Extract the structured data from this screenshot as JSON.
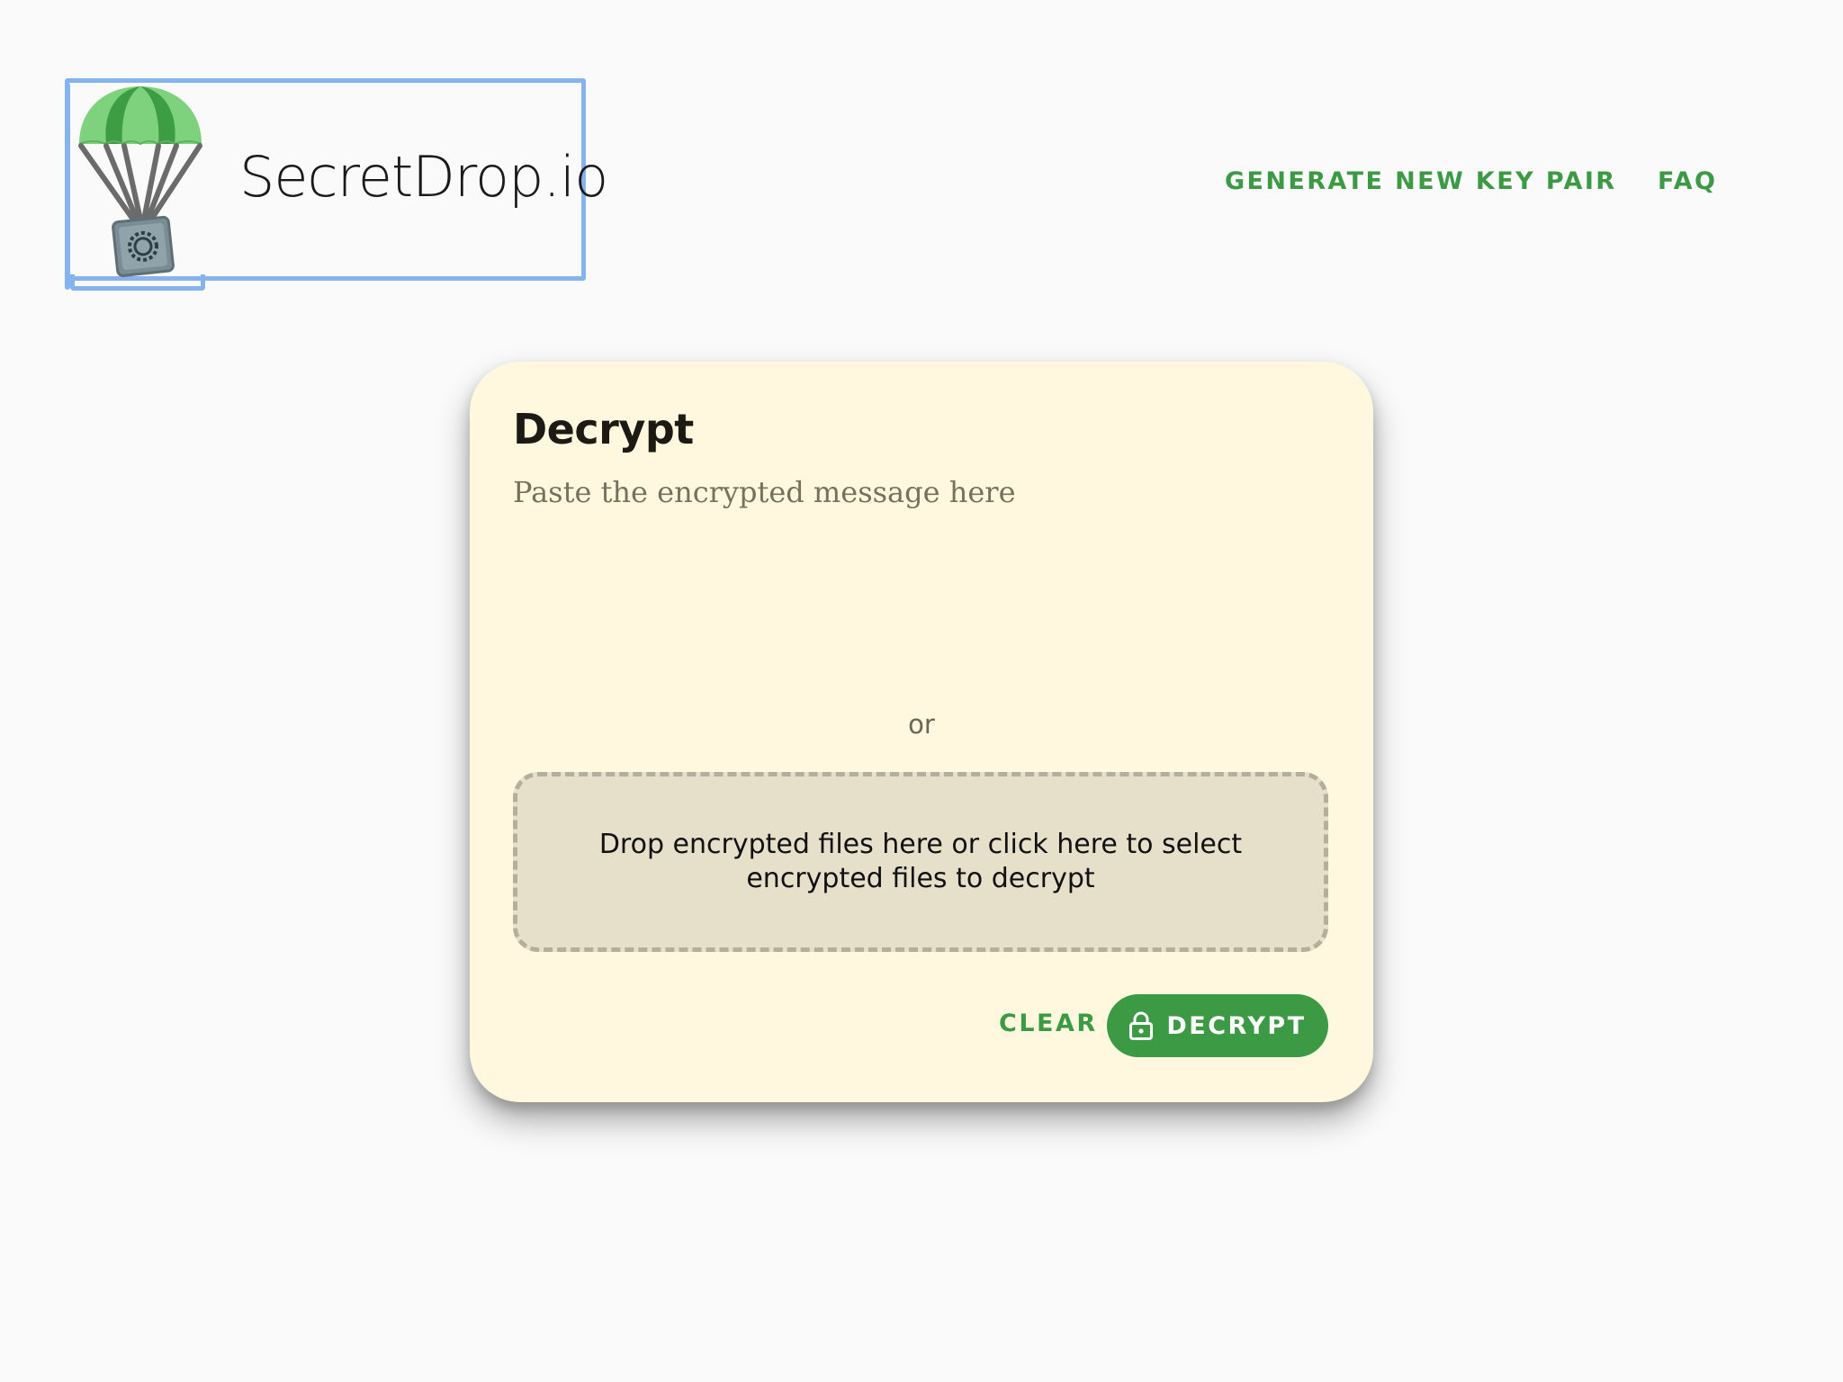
{
  "header": {
    "brand_name": "SecretDrop.io",
    "nav": {
      "generate_label": "GENERATE NEW KEY PAIR",
      "faq_label": "FAQ"
    }
  },
  "decrypt_card": {
    "title": "Decrypt",
    "message_placeholder": "Paste the encrypted message here",
    "message_value": "",
    "or_label": "or",
    "dropzone_text": "Drop encrypted files here or click here to select encrypted files to decrypt",
    "clear_label": "CLEAR",
    "decrypt_label": "DECRYPT"
  },
  "colors": {
    "accent": "#3c9a44",
    "card_background": "#fff8de",
    "dropzone_background": "#e6dfca",
    "page_background": "#fafafa",
    "focus_outline": "#84b3ef"
  },
  "icons": {
    "logo": "parachute-safe-logo",
    "decrypt_button": "lock-icon"
  }
}
